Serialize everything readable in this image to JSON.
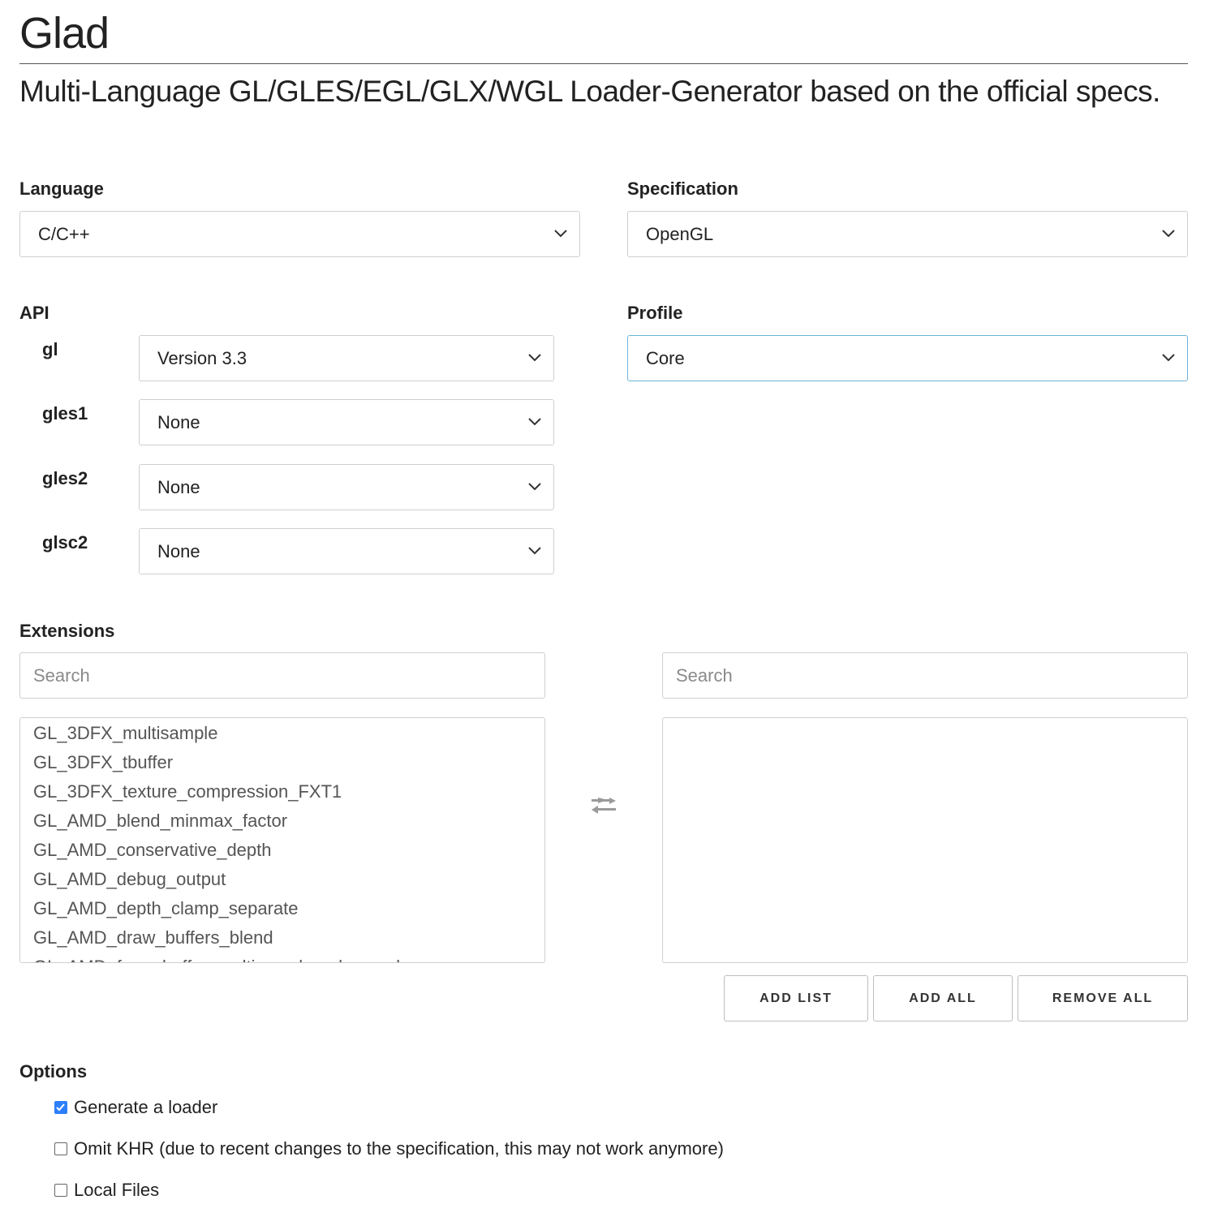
{
  "header": {
    "title": "Glad",
    "subtitle": "Multi-Language GL/GLES/EGL/GLX/WGL Loader-Generator based on the official specs."
  },
  "language": {
    "label": "Language",
    "value": "C/C++"
  },
  "specification": {
    "label": "Specification",
    "value": "OpenGL"
  },
  "api": {
    "label": "API",
    "rows": [
      {
        "name": "gl",
        "value": "Version 3.3"
      },
      {
        "name": "gles1",
        "value": "None"
      },
      {
        "name": "gles2",
        "value": "None"
      },
      {
        "name": "glsc2",
        "value": "None"
      }
    ]
  },
  "profile": {
    "label": "Profile",
    "value": "Core"
  },
  "extensions": {
    "label": "Extensions",
    "left_search_placeholder": "Search",
    "right_search_placeholder": "Search",
    "available": [
      "GL_3DFX_multisample",
      "GL_3DFX_tbuffer",
      "GL_3DFX_texture_compression_FXT1",
      "GL_AMD_blend_minmax_factor",
      "GL_AMD_conservative_depth",
      "GL_AMD_debug_output",
      "GL_AMD_depth_clamp_separate",
      "GL_AMD_draw_buffers_blend",
      "GL_AMD_framebuffer_multisample_advanced"
    ],
    "selected": [],
    "transfer_icon": "swap-arrows-icon",
    "buttons": {
      "add_list": "ADD LIST",
      "add_all": "ADD ALL",
      "remove_all": "REMOVE ALL"
    }
  },
  "options": {
    "label": "Options",
    "items": [
      {
        "label": "Generate a loader",
        "checked": true
      },
      {
        "label": "Omit KHR (due to recent changes to the specification, this may not work anymore)",
        "checked": false
      },
      {
        "label": "Local Files",
        "checked": false
      }
    ]
  },
  "colors": {
    "checkbox_accent": "#2d7ff9",
    "focus_border": "#6cb3d9"
  }
}
